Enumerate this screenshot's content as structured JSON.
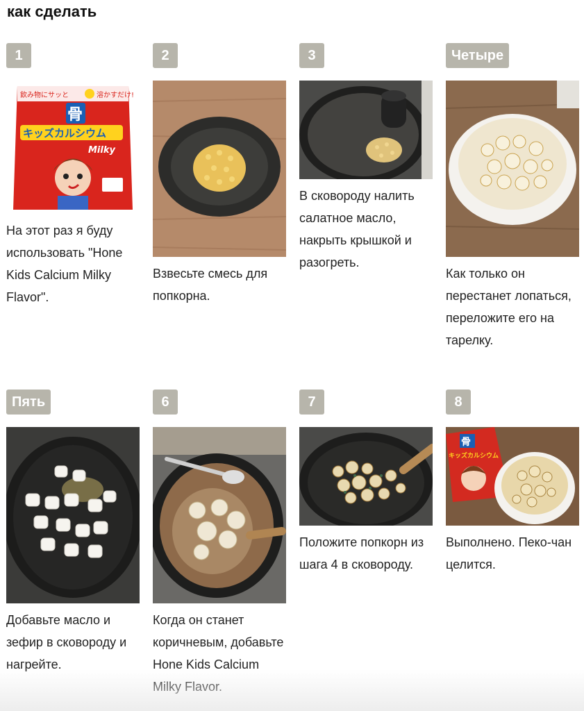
{
  "heading": "как сделать",
  "steps": [
    {
      "badge": "1",
      "text": "На этот раз я буду использовать \"Hone Kids Calcium Milky Flavor\".",
      "pack": {
        "top": "飲み物にサッと",
        "top2": "溶かすだけ!",
        "kanji": "骨",
        "name": "キッズカルシウム",
        "milky": "Milky"
      }
    },
    {
      "badge": "2",
      "text": "Взвесьте смесь для попкорна."
    },
    {
      "badge": "3",
      "text": "В сковороду налить салатное масло, накрыть крышкой и разогреть."
    },
    {
      "badge": "Четыре",
      "text": "Как только он перестанет лопаться, переложите его на тарелку."
    },
    {
      "badge": "Пять",
      "text": "Добавьте масло и зефир в сковороду и нагрейте."
    },
    {
      "badge": "6",
      "text": "Когда он станет коричневым, добавьте Hone Kids Calcium Milky Flavor."
    },
    {
      "badge": "7",
      "text": "Положите попкорн из шага 4 в сковороду."
    },
    {
      "badge": "8",
      "text": "Выполнено. Пеко-чан целится.",
      "pack": {
        "name": "キッズカルシウム",
        "kanji": "骨"
      }
    }
  ]
}
